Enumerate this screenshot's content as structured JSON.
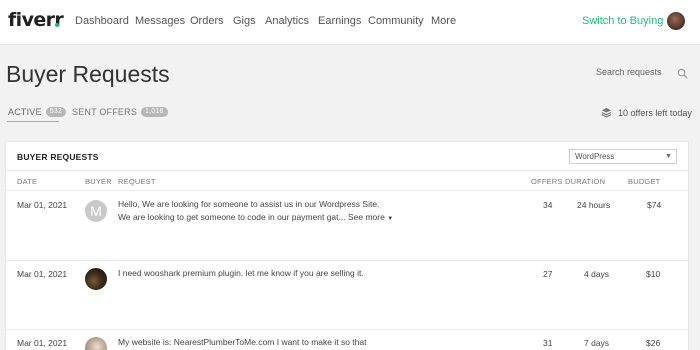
{
  "nav": {
    "logo": "fiverr",
    "items": [
      "Dashboard",
      "Messages",
      "Orders",
      "Gigs",
      "Analytics",
      "Earnings",
      "Community",
      "More"
    ],
    "switch_label": "Switch to Buying"
  },
  "page": {
    "title": "Buyer Requests",
    "search_placeholder": "Search requests"
  },
  "tabs": [
    {
      "label": "ACTIVE",
      "badge": "532"
    },
    {
      "label": "SENT OFFERS",
      "badge": "1,018"
    }
  ],
  "offers_left": "10 offers left today",
  "card": {
    "title": "BUYER REQUESTS",
    "filter_value": "WordPress",
    "columns": [
      "DATE",
      "BUYER",
      "REQUEST",
      "OFFERS",
      "DURATION",
      "BUDGET"
    ],
    "rows": [
      {
        "date": "Mar 01, 2021",
        "buyer_initial": "M",
        "request_line1": "Hello, We are looking for someone to assist us in our Wordpress Site.",
        "request_line2": "We are looking to get someone to code in our payment gat...",
        "see_more": "See more",
        "offers": "34",
        "duration": "24 hours",
        "budget": "$74"
      },
      {
        "date": "Mar 01, 2021",
        "request_line1": "I need wooshark premium plugin. let me know if you are selling it.",
        "offers": "27",
        "duration": "4 days",
        "budget": "$10"
      },
      {
        "date": "Mar 01, 2021",
        "request_line1": "My website is: NearestPlumberToMe.com I want to make it so that",
        "offers": "31",
        "duration": "7 days",
        "budget": "$26"
      }
    ]
  },
  "colors": {
    "brand_green": "#1dbf73",
    "background": "#f2f2f2"
  }
}
